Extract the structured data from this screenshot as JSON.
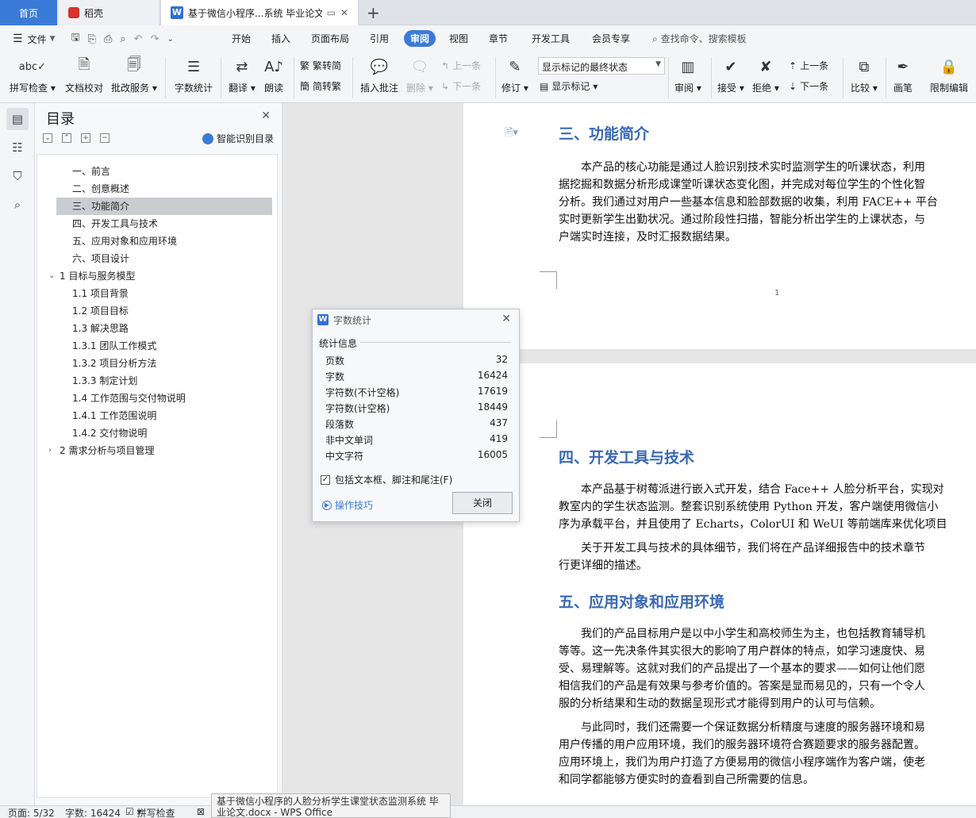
{
  "tabs": {
    "home": "首页",
    "daoke": "稻壳",
    "doc_title": "基于微信小程序...系统 毕业论文",
    "new_tab": "+"
  },
  "menubar": {
    "file": "文件",
    "tabs": [
      "开始",
      "插入",
      "页面布局",
      "引用",
      "审阅",
      "视图",
      "章节",
      "开发工具",
      "会员专享"
    ],
    "active_tab": "审阅",
    "search": "查找命令、搜索模板"
  },
  "ribbon": {
    "spell_check": "拼写检查",
    "doc_proof": "文档校对",
    "batch_service": "批改服务",
    "word_count": "字数统计",
    "translate": "翻译",
    "read_aloud": "朗读",
    "trad_to_simp": "繁转简",
    "simp_to_trad": "简转繁",
    "insert_comment": "插入批注",
    "delete": "删除",
    "prev_comment": "上一条",
    "next_comment": "下一条",
    "track_changes": "修订",
    "markup_select": "显示标记的最终状态",
    "show_markup": "显示标记",
    "review": "审阅",
    "accept": "接受",
    "reject": "拒绝",
    "prev_change": "上一条",
    "next_change": "下一条",
    "compare": "比较",
    "pen": "画笔",
    "restrict_edit": "限制编辑"
  },
  "toc": {
    "title": "目录",
    "smart_toc": "智能识别目录",
    "items": [
      {
        "label": "一、前言",
        "level": 2
      },
      {
        "label": "二、创意概述",
        "level": 2
      },
      {
        "label": "三、功能简介",
        "level": 2,
        "selected": true
      },
      {
        "label": "四、开发工具与技术",
        "level": 2
      },
      {
        "label": "五、应用对象和应用环境",
        "level": 2
      },
      {
        "label": "六、项目设计",
        "level": 2
      },
      {
        "label": "1 目标与服务模型",
        "level": 1,
        "expanded": true
      },
      {
        "label": "1.1 项目背景",
        "level": 2
      },
      {
        "label": "1.2 项目目标",
        "level": 2
      },
      {
        "label": "1.3 解决思路",
        "level": 2
      },
      {
        "label": "1.3.1 团队工作模式",
        "level": 2
      },
      {
        "label": "1.3.2 项目分析方法",
        "level": 2
      },
      {
        "label": "1.3.3 制定计划",
        "level": 2
      },
      {
        "label": "1.4 工作范围与交付物说明",
        "level": 2
      },
      {
        "label": "1.4.1 工作范围说明",
        "level": 2
      },
      {
        "label": "1.4.2 交付物说明",
        "level": 2
      },
      {
        "label": "2 需求分析与项目管理",
        "level": 1,
        "expanded": false
      }
    ]
  },
  "document": {
    "page1": {
      "heading": "三、功能简介",
      "para": [
        "　　本产品的核心功能是通过人脸识别技术实时监测学生的听课状态，利用",
        "据挖掘和数据分析形成课堂听课状态变化图，并完成对每位学生的个性化智",
        "分析。我们通过对用户一些基本信息和脸部数据的收集，利用 FACE++ 平台",
        "实时更新学生出勤状况。通过阶段性扫描，智能分析出学生的上课状态，与",
        "户端实时连接，及时汇报数据结果。"
      ],
      "page_number": "1"
    },
    "page2": {
      "heading1": "四、开发工具与技术",
      "para1": [
        "　　本产品基于树莓派进行嵌入式开发，结合 Face++ 人脸分析平台，实现对",
        "教室内的学生状态监测。整套识别系统使用 Python 开发，客户端使用微信小",
        "序为承载平台，并且使用了 Echarts，ColorUI 和 WeUI 等前端库来优化项目"
      ],
      "para2": [
        "　　关于开发工具与技术的具体细节，我们将在产品详细报告中的技术章节",
        "行更详细的描述。"
      ],
      "heading2": "五、应用对象和应用环境",
      "para3": [
        "　　我们的产品目标用户是以中小学生和高校师生为主，也包括教育辅导机",
        "等等。这一先决条件其实很大的影响了用户群体的特点，如学习速度快、易",
        "受、易理解等。这就对我们的产品提出了一个基本的要求——如何让他们愿",
        "相信我们的产品是有效果与参考价值的。答案是显而易见的，只有一个令人",
        "服的分析结果和生动的数据呈现形式才能得到用户的认可与信赖。"
      ],
      "para4": [
        "　　与此同时，我们还需要一个保证数据分析精度与速度的服务器环境和易",
        "用户传播的用户应用环境，我们的服务器环境符合赛题要求的服务器配置。",
        "应用环境上，我们为用户打造了方便易用的微信小程序端作为客户端，使老",
        "和同学都能够方便实时的查看到自己所需要的信息。"
      ]
    }
  },
  "dialog": {
    "title": "字数统计",
    "section": "统计信息",
    "rows": [
      {
        "label": "页数",
        "value": "32"
      },
      {
        "label": "字数",
        "value": "16424"
      },
      {
        "label": "字符数(不计空格)",
        "value": "17619"
      },
      {
        "label": "字符数(计空格)",
        "value": "18449"
      },
      {
        "label": "段落数",
        "value": "437"
      },
      {
        "label": "非中文单词",
        "value": "419"
      },
      {
        "label": "中文字符",
        "value": "16005"
      }
    ],
    "include_label": "包括文本框、脚注和尾注(F)",
    "include_checked": true,
    "tips": "操作技巧",
    "close": "关闭"
  },
  "status": {
    "page": "页面: 5/32",
    "words": "字数: 16424",
    "spell": "拼写检查",
    "tooltip": "基于微信小程序的人脸分析学生课堂状态监测系统 毕业论文.docx - WPS Office"
  }
}
